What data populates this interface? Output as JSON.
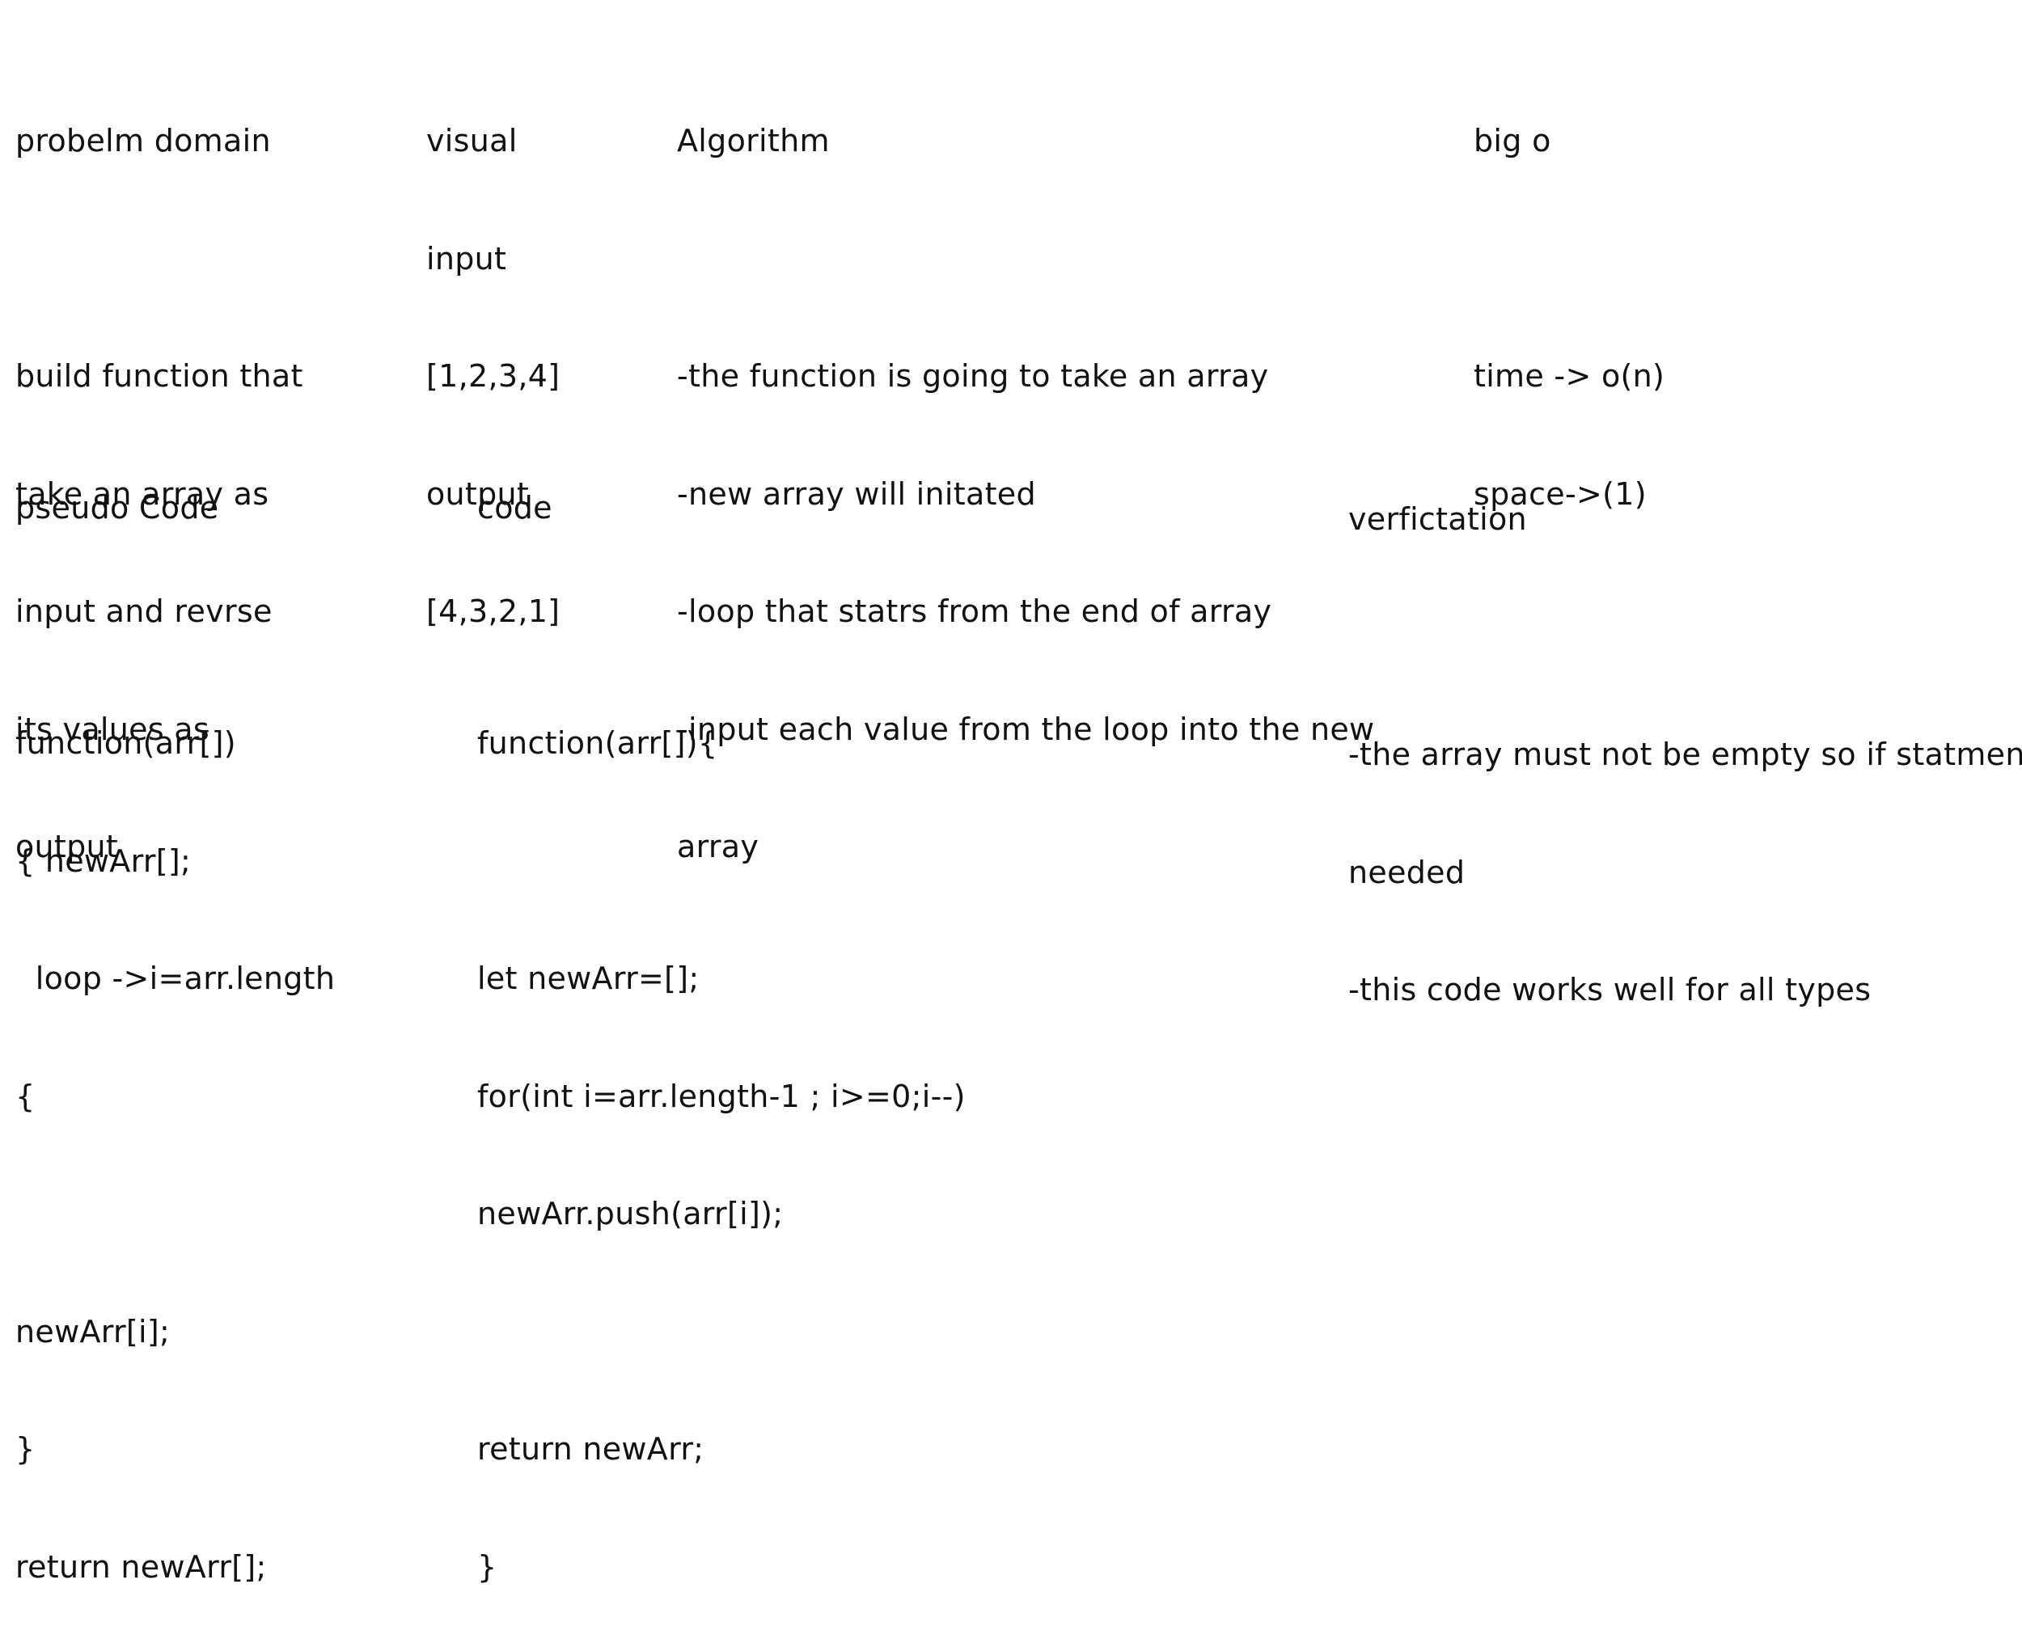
{
  "problem_domain": {
    "lines": [
      "probelm domain",
      "",
      "build function that",
      "take an array as",
      "input and revrse",
      "its values as",
      "output"
    ]
  },
  "visual": {
    "lines": [
      "visual",
      "input",
      "[1,2,3,4]",
      "output",
      "[4,3,2,1]"
    ]
  },
  "algorithm": {
    "lines": [
      "Algorithm",
      "",
      "-the function is going to take an array",
      "-new array will initated",
      "-loop that statrs from the end of array",
      "-input each value from the loop into the new",
      "array"
    ]
  },
  "big_o": {
    "lines": [
      "big o",
      "",
      "time -> o(n)",
      "space->(1)"
    ]
  },
  "pseudo_code": {
    "lines": [
      "pseudo Code",
      "",
      "function(arr[])",
      "{ newArr[];",
      "  loop ->i=arr.length",
      "{",
      "",
      "newArr[i];",
      "}",
      "return newArr[];"
    ]
  },
  "code": {
    "lines": [
      "code",
      "",
      "function(arr[]){",
      "",
      "let newArr=[];",
      "for(int i=arr.length-1 ; i>=0;i--)",
      "newArr.push(arr[i]);",
      "",
      "return newArr;",
      "}"
    ]
  },
  "verification": {
    "lines": [
      "verfictation",
      "",
      "-the array must not be empty so if statment",
      "needed",
      "-this code works well for all types"
    ]
  }
}
